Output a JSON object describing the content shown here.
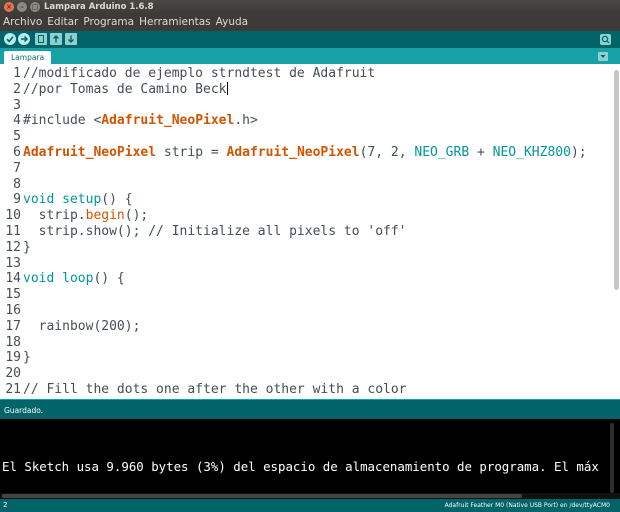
{
  "window": {
    "title": "Lampara Arduino 1.6.8",
    "close_glyph": "×",
    "min_glyph": "–",
    "max_glyph": "□"
  },
  "menu": [
    "Archivo",
    "Editar",
    "Programa",
    "Herramientas",
    "Ayuda"
  ],
  "toolbar": {
    "verify_icon": "check-icon",
    "upload_icon": "arrow-right-icon",
    "new_icon": "new-file-icon",
    "open_icon": "arrow-up-icon",
    "save_icon": "arrow-down-icon",
    "serial_icon": "magnifier-icon"
  },
  "tabs": [
    {
      "label": "Lampara"
    }
  ],
  "editor": {
    "lines": [
      {
        "n": "1",
        "tokens": [
          {
            "t": "//modificado de ejemplo strndtest de Adafruit",
            "c": "cm"
          }
        ]
      },
      {
        "n": "2",
        "tokens": [
          {
            "t": "//por Tomas de Camino Beck",
            "c": "cm"
          }
        ],
        "cursor": true
      },
      {
        "n": "3",
        "tokens": []
      },
      {
        "n": "4",
        "tokens": [
          {
            "t": "#include <",
            "c": ""
          },
          {
            "t": "Adafruit_NeoPixel",
            "c": "lib"
          },
          {
            "t": ".h>",
            "c": ""
          }
        ]
      },
      {
        "n": "5",
        "tokens": []
      },
      {
        "n": "6",
        "tokens": [
          {
            "t": "Adafruit_NeoPixel",
            "c": "lib"
          },
          {
            "t": " strip = ",
            "c": ""
          },
          {
            "t": "Adafruit_NeoPixel",
            "c": "lib"
          },
          {
            "t": "(7, 2, ",
            "c": ""
          },
          {
            "t": "NEO_GRB",
            "c": "const"
          },
          {
            "t": " + ",
            "c": ""
          },
          {
            "t": "NEO_KHZ800",
            "c": "const"
          },
          {
            "t": ");",
            "c": ""
          }
        ]
      },
      {
        "n": "7",
        "tokens": []
      },
      {
        "n": "8",
        "tokens": []
      },
      {
        "n": "9",
        "tokens": [
          {
            "t": "void",
            "c": "kw"
          },
          {
            "t": " ",
            "c": ""
          },
          {
            "t": "setup",
            "c": "kw"
          },
          {
            "t": "() {",
            "c": ""
          }
        ]
      },
      {
        "n": "10",
        "tokens": [
          {
            "t": "  strip.",
            "c": ""
          },
          {
            "t": "begin",
            "c": "fn"
          },
          {
            "t": "();",
            "c": ""
          }
        ]
      },
      {
        "n": "11",
        "tokens": [
          {
            "t": "  strip.show(); // Initialize all pixels to 'off'",
            "c": ""
          }
        ]
      },
      {
        "n": "12",
        "tokens": [
          {
            "t": "}",
            "c": ""
          }
        ]
      },
      {
        "n": "13",
        "tokens": []
      },
      {
        "n": "14",
        "tokens": [
          {
            "t": "void",
            "c": "kw"
          },
          {
            "t": " ",
            "c": ""
          },
          {
            "t": "loop",
            "c": "kw"
          },
          {
            "t": "() {",
            "c": ""
          }
        ]
      },
      {
        "n": "15",
        "tokens": []
      },
      {
        "n": "16",
        "tokens": []
      },
      {
        "n": "17",
        "tokens": [
          {
            "t": "  rainbow(200);",
            "c": ""
          }
        ]
      },
      {
        "n": "18",
        "tokens": []
      },
      {
        "n": "19",
        "tokens": [
          {
            "t": "}",
            "c": ""
          }
        ]
      },
      {
        "n": "20",
        "tokens": []
      },
      {
        "n": "21",
        "tokens": [
          {
            "t": "// Fill the dots one after the other with a color",
            "c": "cm"
          }
        ]
      }
    ]
  },
  "status": {
    "text": "Guardado."
  },
  "console": {
    "text": "El Sketch usa 9.960 bytes (3%) del espacio de almacenamiento de programa. El máx"
  },
  "footer": {
    "line": "2",
    "board": "Adafruit Feather M0 (Native USB Port) en /dev/ttyACM0"
  },
  "colors": {
    "teal_dark": "#006468",
    "teal_light": "#17a1a5",
    "keyword": "#00979c",
    "library": "#d35400"
  }
}
